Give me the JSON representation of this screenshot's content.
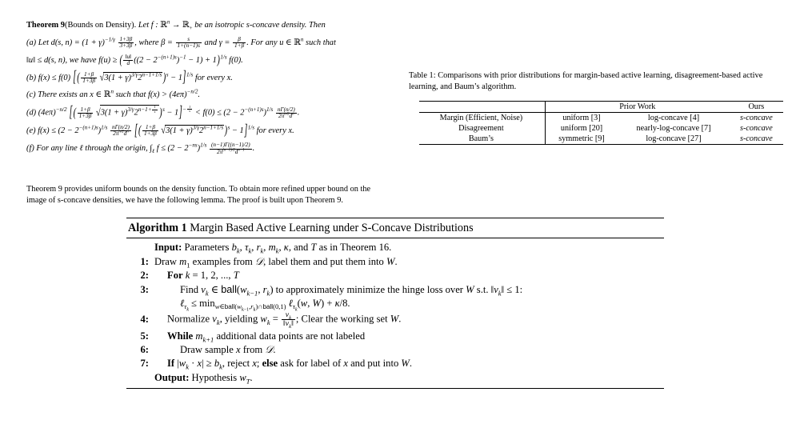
{
  "document": {
    "type": "academic-paper-page",
    "theorem": {
      "label": "Theorem 9",
      "title": "(Bounds on Density).",
      "intro": "Let f : R^n -> R_+ be an isotropic s-concave density. Then",
      "items": [
        {
          "tag": "(a)",
          "text": "Let d(s,n) = (1+γ)^{-1/γ} (1+3β)/(3+3β), where β = s/(1+(n-1)s) and γ = β/(1+β). For any u ∈ R^n such that ||u|| ≤ d(s,n), we have f(u) ≥ ( ||u||/d ((2-2^{-(n+1)s})^{-1} - 1) + 1 )^{1/s} f(0)."
        },
        {
          "tag": "(b)",
          "text": "f(x) ≤ f(0) [ ( (1+β)/(1+3β) sqrt(3(1+γ)^{3/γ}) 2^{n-1+1/s} )^s - 1 ]^{1/s} for every x."
        },
        {
          "tag": "(c)",
          "text": "There exists an x ∈ R^n such that f(x) > (4eπ)^{-n/2}."
        },
        {
          "tag": "(d)",
          "text": "(4eπ)^{-n/2} [ ( (1+β)/(1+3β) sqrt(3(1+γ)^{3/γ}) 2^{n-1+1/s} )^s - 1 ]^{-1/s} < f(0) ≤ (2-2^{-(n+1)s})^{1/s} nΓ(n/2) / (2π^{n/2} d^n)."
        },
        {
          "tag": "(e)",
          "text": "f(x) ≤ (2-2^{-(n+1)s})^{1/s} nΓ(n/2)/(2π^{n/2} d^n) [ ( (1+β)/(1+3β) sqrt(3(1+γ)^{3/γ}) 2^{n-1+1/s} )^s - 1 ]^{1/s} for every x."
        },
        {
          "tag": "(f)",
          "text": "For any line ℓ through the origin, ∫_ℓ f ≤ (2-2^{-ns})^{1/s} (n-1)Γ((n-1)/2) / (2π^{(n-1)/2} d^{n-1})."
        }
      ],
      "following_paragraph": "Theorem 9 provides uniform bounds on the density function. To obtain more refined upper bound on the image of s-concave densities, we have the following lemma. The proof is built upon Theorem 9."
    },
    "table": {
      "caption_label": "Table 1:",
      "caption_text": "Comparisons with prior distributions for margin-based active learning, disagreement-based active learning, and Baum’s algorithm.",
      "group_headers": {
        "prior_work": "Prior Work",
        "ours": "Ours"
      },
      "rows": [
        {
          "method": "Margin (Efficient, Noise)",
          "prior1": "uniform [3]",
          "prior2": "log-concave [4]",
          "ours": "s-concave"
        },
        {
          "method": "Disagreement",
          "prior1": "uniform [20]",
          "prior2": "nearly-log-concave [7]",
          "ours": "s-concave"
        },
        {
          "method": "Baum’s",
          "prior1": "symmetric [9]",
          "prior2": "log-concave [27]",
          "ours": "s-concave"
        }
      ]
    },
    "algorithm": {
      "label": "Algorithm 1",
      "title": "Margin Based Active Learning under S-Concave Distributions",
      "input_label": "Input:",
      "input_text": "Parameters b_k, τ_k, r_k, m_k, κ, and T as in Theorem 16.",
      "output_label": "Output:",
      "output_text": "Hypothesis w_T.",
      "steps": [
        {
          "num": "1:",
          "text": "Draw m_1 examples from D, label them and put them into W."
        },
        {
          "num": "2:",
          "keyword": "For",
          "text": "k = 1, 2, ..., T"
        },
        {
          "num": "3:",
          "text": "Find v_k ∈ ball(w_{k-1}, r_k) to approximately minimize the hinge loss over W s.t. ||v_k|| ≤ 1:",
          "continuation": "ℓ_{τ_k} ≤ min_{w∈ball(w_{k-1},r_k)∩ball(0,1)} ℓ_{τ_k}(w, W) + κ/8."
        },
        {
          "num": "4:",
          "text": "Normalize v_k, yielding w_k = v_k/||v_k||; Clear the working set W."
        },
        {
          "num": "5:",
          "keyword": "While",
          "text": "m_{k+1} additional data points are not labeled"
        },
        {
          "num": "6:",
          "text": "Draw sample x from D."
        },
        {
          "num": "7:",
          "keyword": "If",
          "text": "|w_k · x| ≥ b_k, reject x; else ask for label of x and put into W."
        }
      ]
    }
  }
}
